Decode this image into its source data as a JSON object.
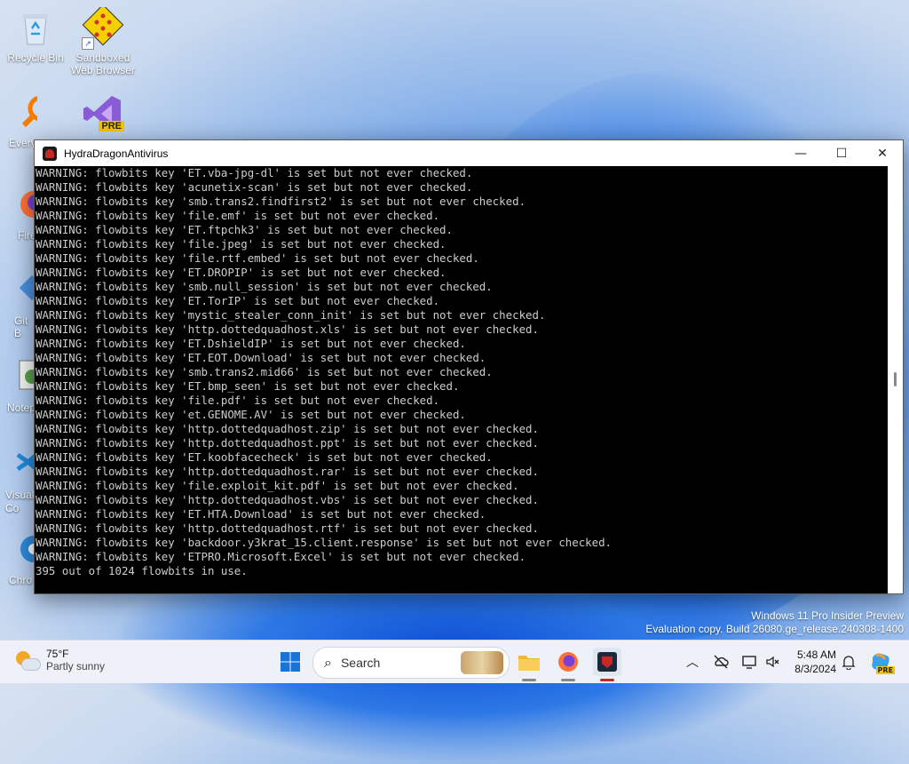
{
  "desktop": {
    "icons": [
      {
        "label": "Recycle Bin"
      },
      {
        "label": "Sandboxed Web Browser"
      },
      {
        "label": "Every"
      },
      {
        "label": "Fire"
      },
      {
        "label": "Git B"
      },
      {
        "label": "Notep"
      },
      {
        "label": "Visual Co"
      },
      {
        "label": "Chro"
      }
    ],
    "pre_badge": "PRE"
  },
  "window": {
    "title": "HydraDragonAntivirus",
    "minimize": "—",
    "maximize": "☐",
    "close": "✕",
    "lines": [
      "WARNING: flowbits key 'ET.vba-jpg-dl' is set but not ever checked.",
      "WARNING: flowbits key 'acunetix-scan' is set but not ever checked.",
      "WARNING: flowbits key 'smb.trans2.findfirst2' is set but not ever checked.",
      "WARNING: flowbits key 'file.emf' is set but not ever checked.",
      "WARNING: flowbits key 'ET.ftpchk3' is set but not ever checked.",
      "WARNING: flowbits key 'file.jpeg' is set but not ever checked.",
      "WARNING: flowbits key 'file.rtf.embed' is set but not ever checked.",
      "WARNING: flowbits key 'ET.DROPIP' is set but not ever checked.",
      "WARNING: flowbits key 'smb.null_session' is set but not ever checked.",
      "WARNING: flowbits key 'ET.TorIP' is set but not ever checked.",
      "WARNING: flowbits key 'mystic_stealer_conn_init' is set but not ever checked.",
      "WARNING: flowbits key 'http.dottedquadhost.xls' is set but not ever checked.",
      "WARNING: flowbits key 'ET.DshieldIP' is set but not ever checked.",
      "WARNING: flowbits key 'ET.EOT.Download' is set but not ever checked.",
      "WARNING: flowbits key 'smb.trans2.mid66' is set but not ever checked.",
      "WARNING: flowbits key 'ET.bmp_seen' is set but not ever checked.",
      "WARNING: flowbits key 'file.pdf' is set but not ever checked.",
      "WARNING: flowbits key 'et.GENOME.AV' is set but not ever checked.",
      "WARNING: flowbits key 'http.dottedquadhost.zip' is set but not ever checked.",
      "WARNING: flowbits key 'http.dottedquadhost.ppt' is set but not ever checked.",
      "WARNING: flowbits key 'ET.koobfacecheck' is set but not ever checked.",
      "WARNING: flowbits key 'http.dottedquadhost.rar' is set but not ever checked.",
      "WARNING: flowbits key 'file.exploit_kit.pdf' is set but not ever checked.",
      "WARNING: flowbits key 'http.dottedquadhost.vbs' is set but not ever checked.",
      "WARNING: flowbits key 'ET.HTA.Download' is set but not ever checked.",
      "WARNING: flowbits key 'http.dottedquadhost.rtf' is set but not ever checked.",
      "WARNING: flowbits key 'backdoor.y3krat_15.client.response' is set but not ever checked.",
      "WARNING: flowbits key 'ETPRO.Microsoft.Excel' is set but not ever checked.",
      "395 out of 1024 flowbits in use."
    ]
  },
  "watermark": {
    "line1": "Windows 11 Pro Insider Preview",
    "line2": "Evaluation copy. Build 26080.ge_release.240308-1400"
  },
  "taskbar": {
    "weather_temp": "75°F",
    "weather_desc": "Partly sunny",
    "search_placeholder": "Search",
    "time": "5:48 AM",
    "date": "8/3/2024",
    "copilot_badge": "PRE"
  }
}
